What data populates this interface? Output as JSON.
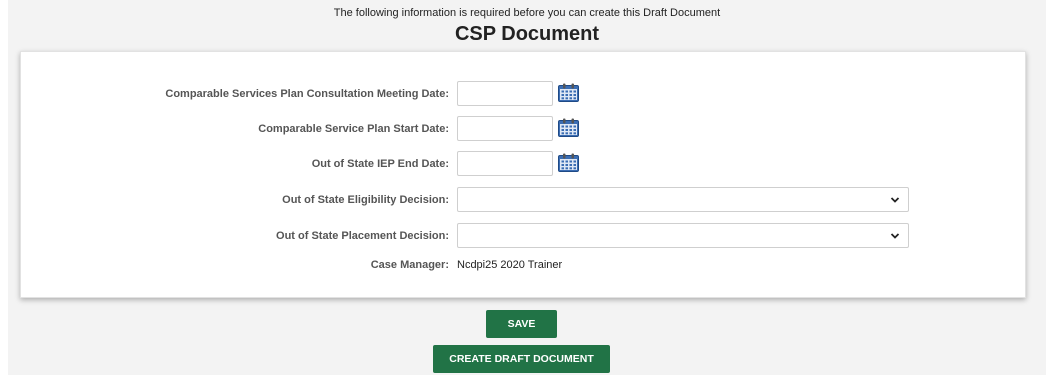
{
  "header": {
    "notice": "The following information is required before you can create this Draft Document",
    "title": "CSP Document"
  },
  "form": {
    "consultation_date": {
      "label": "Comparable Services Plan Consultation Meeting Date:",
      "value": ""
    },
    "start_date": {
      "label": "Comparable Service Plan Start Date:",
      "value": ""
    },
    "iep_end_date": {
      "label": "Out of State IEP End Date:",
      "value": ""
    },
    "eligibility_decision": {
      "label": "Out of State Eligibility Decision:",
      "selected": ""
    },
    "placement_decision": {
      "label": "Out of State Placement Decision:",
      "selected": ""
    },
    "case_manager": {
      "label": "Case Manager:",
      "value": "Ncdpi25 2020 Trainer"
    }
  },
  "actions": {
    "save_label": "SAVE",
    "create_label": "CREATE DRAFT DOCUMENT"
  },
  "colors": {
    "button_green": "#217346",
    "calendar_blue": "#2f5d9e"
  },
  "icons": {
    "calendar": "calendar-icon",
    "dropdown": "chevron-down-icon"
  }
}
